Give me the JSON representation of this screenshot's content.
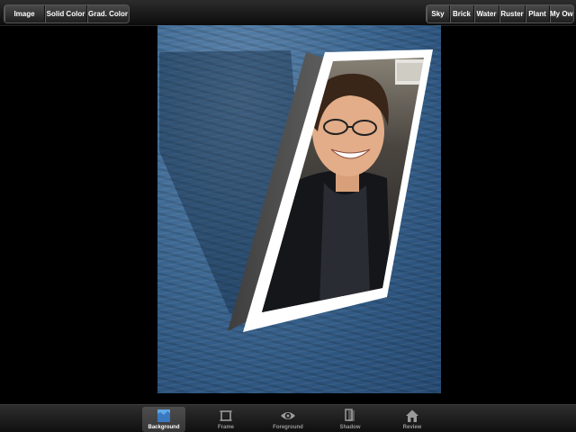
{
  "top_toolbar": {
    "left_segment": [
      {
        "label": "Image",
        "selected": false
      },
      {
        "label": "Solid Color",
        "selected": false
      },
      {
        "label": "Grad. Color",
        "selected": false
      }
    ],
    "right_segment": [
      {
        "label": "Sky",
        "selected": false
      },
      {
        "label": "Brick",
        "selected": false
      },
      {
        "label": "Water",
        "selected": true
      },
      {
        "label": "Ruster",
        "selected": false
      },
      {
        "label": "Plant",
        "selected": false
      },
      {
        "label": "My Own",
        "selected": false
      }
    ]
  },
  "canvas": {
    "background_texture": "water",
    "photo_subject": "smiling man with glasses",
    "frame_color": "#ffffff",
    "frame_side_color": "#555555",
    "water_color": "#2e5680"
  },
  "bottom_tabs": [
    {
      "label": "Background",
      "icon": "background-icon",
      "selected": true
    },
    {
      "label": "Frame",
      "icon": "frame-icon",
      "selected": false
    },
    {
      "label": "Foreground",
      "icon": "eye-icon",
      "selected": false
    },
    {
      "label": "Shadow",
      "icon": "shadow-icon",
      "selected": false
    },
    {
      "label": "Review",
      "icon": "house-icon",
      "selected": false
    }
  ]
}
